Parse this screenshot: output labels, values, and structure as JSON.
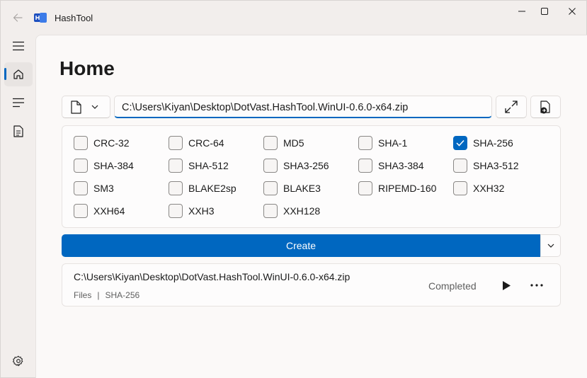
{
  "window": {
    "title": "HashTool",
    "accent": "#0067c0"
  },
  "nav": {
    "items": [
      {
        "name": "menu",
        "icon": "hamburger-icon"
      },
      {
        "name": "home",
        "icon": "home-icon",
        "selected": true
      },
      {
        "name": "tasks",
        "icon": "list-icon"
      },
      {
        "name": "documents",
        "icon": "document-icon"
      },
      {
        "name": "settings",
        "icon": "gear-icon"
      }
    ]
  },
  "page": {
    "title": "Home"
  },
  "input": {
    "path": "C:\\Users\\Kiyan\\Desktop\\DotVast.HashTool.WinUI-0.6.0-x64.zip"
  },
  "algorithms": [
    {
      "label": "CRC-32",
      "checked": false
    },
    {
      "label": "CRC-64",
      "checked": false
    },
    {
      "label": "MD5",
      "checked": false
    },
    {
      "label": "SHA-1",
      "checked": false
    },
    {
      "label": "SHA-256",
      "checked": true
    },
    {
      "label": "SHA-384",
      "checked": false
    },
    {
      "label": "SHA-512",
      "checked": false
    },
    {
      "label": "SHA3-256",
      "checked": false
    },
    {
      "label": "SHA3-384",
      "checked": false
    },
    {
      "label": "SHA3-512",
      "checked": false
    },
    {
      "label": "SM3",
      "checked": false
    },
    {
      "label": "BLAKE2sp",
      "checked": false
    },
    {
      "label": "BLAKE3",
      "checked": false
    },
    {
      "label": "RIPEMD-160",
      "checked": false
    },
    {
      "label": "XXH32",
      "checked": false
    },
    {
      "label": "XXH64",
      "checked": false
    },
    {
      "label": "XXH3",
      "checked": false
    },
    {
      "label": "XXH128",
      "checked": false
    }
  ],
  "actions": {
    "create_label": "Create"
  },
  "task": {
    "path": "C:\\Users\\Kiyan\\Desktop\\DotVast.HashTool.WinUI-0.6.0-x64.zip",
    "mode": "Files",
    "separator": "|",
    "algorithm": "SHA-256",
    "status": "Completed"
  }
}
